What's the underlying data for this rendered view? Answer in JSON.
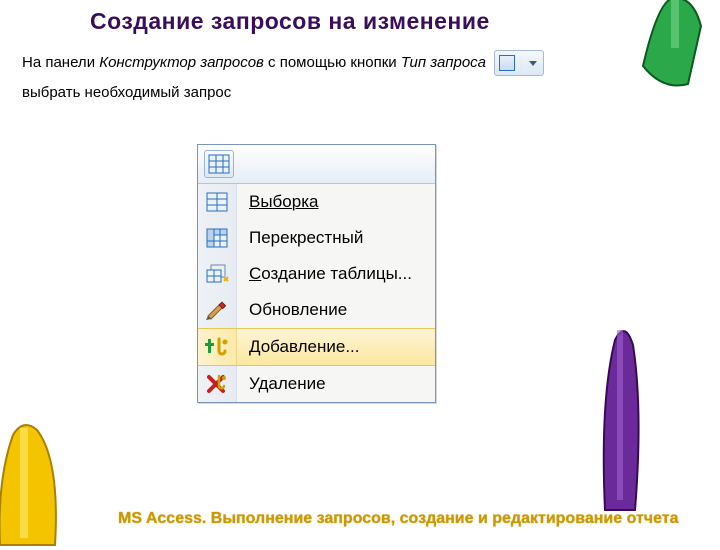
{
  "title": "Создание запросов на изменение",
  "body": {
    "part1": "На панели ",
    "italic1": "Конструктор запросов",
    "part2": " с помощью кнопки ",
    "italic2": "Тип запроса",
    "part3": " выбрать необходимый запрос"
  },
  "menu": {
    "items": [
      {
        "label": "Выборка",
        "underline_first": true,
        "highlight": false,
        "icon": "select"
      },
      {
        "label": "Перекрестный",
        "underline_first": false,
        "highlight": false,
        "icon": "crosstab"
      },
      {
        "label": "Создание таблицы...",
        "underline_first": false,
        "highlight": false,
        "icon": "maketable",
        "underline_char": "С"
      },
      {
        "label": "Обновление",
        "underline_first": false,
        "highlight": false,
        "icon": "update"
      },
      {
        "label": "Добавление...",
        "underline_first": false,
        "highlight": true,
        "icon": "append"
      },
      {
        "label": "Удаление",
        "underline_first": false,
        "highlight": false,
        "icon": "delete"
      }
    ]
  },
  "footer": "MS Access. Выполнение запросов, создание и редактирование отчета"
}
